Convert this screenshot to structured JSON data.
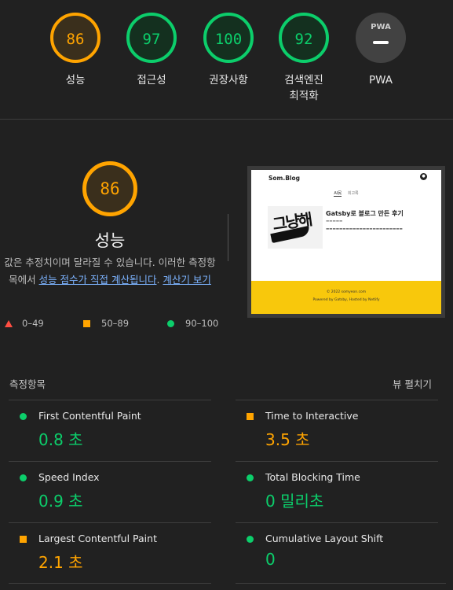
{
  "gauges": [
    {
      "score": "86",
      "label": "성능",
      "status": "orange"
    },
    {
      "score": "97",
      "label": "접근성",
      "status": "green"
    },
    {
      "score": "100",
      "label": "권장사항",
      "status": "green"
    },
    {
      "score": "92",
      "label": "검색엔진\n최적화",
      "status": "green"
    },
    {
      "score": "",
      "label": "PWA",
      "status": "pwa",
      "badge": "PWA"
    }
  ],
  "category": {
    "score": "86",
    "title": "성능",
    "desc_pre": "값은 추정치이며 달라질 수 있습니다. 이러한 측정항목에서 ",
    "link1": "성능 점수가 직접 계산됩니다",
    "desc_mid": ". ",
    "link2": "계산기 보기",
    "desc_post": ""
  },
  "legend": {
    "fail": "0–49",
    "average": "50–89",
    "pass": "90–100"
  },
  "thumbnail": {
    "brand": "Som.Blog",
    "nav": [
      "AI民",
      "회고록"
    ],
    "post_title": "Gatsby로 블로그 만든 후기",
    "logo_text": "그냥해",
    "footer": [
      "© 2022 somyeon.com",
      "Powered by Gatsby, Hosted by Netlify"
    ]
  },
  "audits": {
    "heading": "측정항목",
    "expand_label": "뷰 펼치기",
    "metrics": [
      {
        "name": "First Contentful Paint",
        "value": "0.8 초",
        "status": "green"
      },
      {
        "name": "Time to Interactive",
        "value": "3.5 초",
        "status": "orange"
      },
      {
        "name": "Speed Index",
        "value": "0.9 초",
        "status": "green"
      },
      {
        "name": "Total Blocking Time",
        "value": "0 밀리초",
        "status": "green"
      },
      {
        "name": "Largest Contentful Paint",
        "value": "2.1 초",
        "status": "orange"
      },
      {
        "name": "Cumulative Layout Shift",
        "value": "0",
        "status": "green"
      }
    ]
  },
  "colors": {
    "pass": "#0cce6b",
    "average": "#ffa400",
    "fail": "#ff4e42",
    "background": "#212121"
  }
}
